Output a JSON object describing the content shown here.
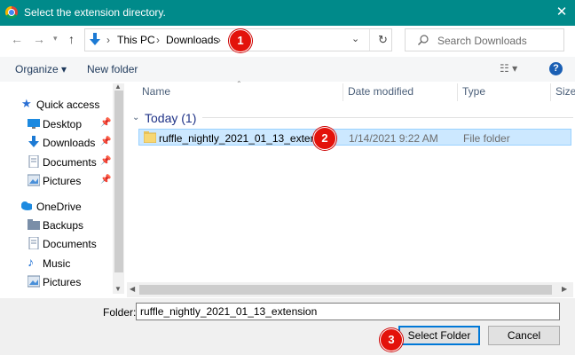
{
  "window": {
    "title": "Select the extension directory."
  },
  "address": {
    "path": [
      "This PC",
      "Downloads"
    ],
    "separator": "›"
  },
  "search": {
    "placeholder": "Search Downloads"
  },
  "toolbar": {
    "organize": "Organize ▾",
    "new_folder": "New folder"
  },
  "nav": {
    "items": [
      {
        "label": "Quick access",
        "icon": "star-icon"
      },
      {
        "label": "Desktop",
        "icon": "desktop-icon",
        "pinned": true
      },
      {
        "label": "Downloads",
        "icon": "download-icon",
        "pinned": true
      },
      {
        "label": "Documents",
        "icon": "document-icon",
        "pinned": true
      },
      {
        "label": "Pictures",
        "icon": "picture-icon",
        "pinned": true
      },
      {
        "label": "OneDrive",
        "icon": "cloud-icon"
      },
      {
        "label": "Backups",
        "icon": "folder-icon"
      },
      {
        "label": "Documents",
        "icon": "document-icon"
      },
      {
        "label": "Music",
        "icon": "music-icon"
      },
      {
        "label": "Pictures",
        "icon": "picture-icon"
      }
    ]
  },
  "columns": [
    "Name",
    "Date modified",
    "Type",
    "Size"
  ],
  "group": {
    "label": "Today (1)"
  },
  "files": [
    {
      "name": "ruffle_nightly_2021_01_13_extension",
      "date": "1/14/2021 9:22 AM",
      "type": "File folder"
    }
  ],
  "footer": {
    "folder_label": "Folder:",
    "folder_value": "ruffle_nightly_2021_01_13_extension",
    "select_button": "Select Folder",
    "cancel_button": "Cancel"
  },
  "badges": [
    "1",
    "2",
    "3"
  ],
  "colors": {
    "titlebar": "#008a8a",
    "selection": "#cce8ff",
    "badge": "#e3120b",
    "link": "#1e395b"
  }
}
